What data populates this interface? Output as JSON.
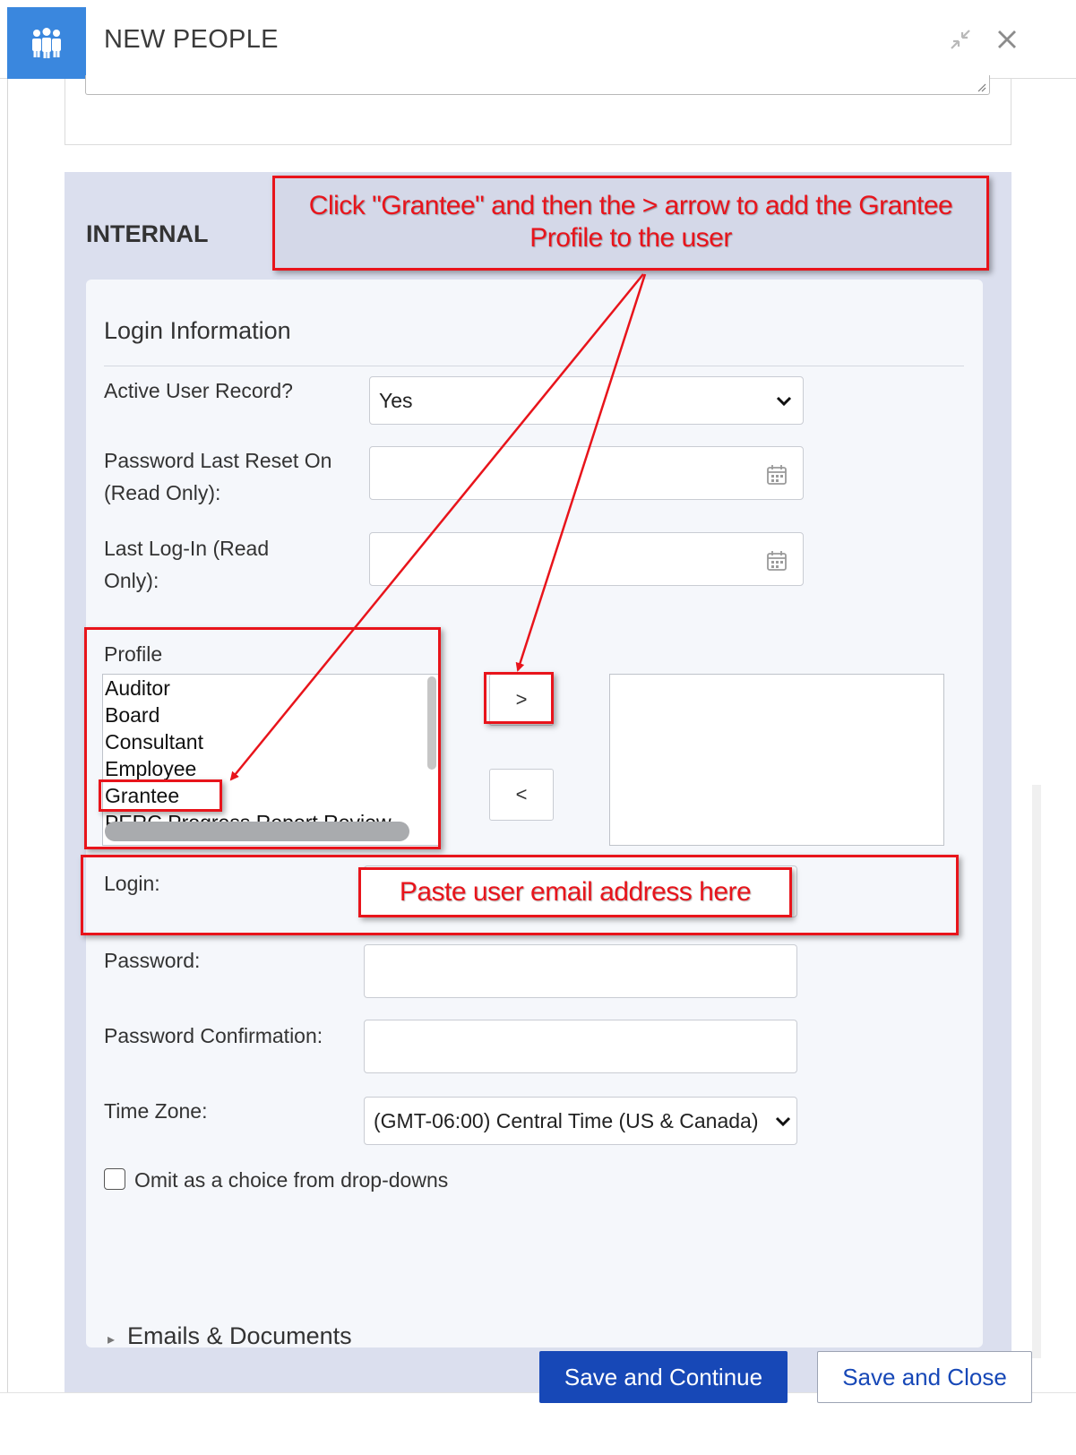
{
  "dialog": {
    "title": "NEW PEOPLE",
    "app_icon": "people-group-icon",
    "accent_color": "#3a87de",
    "controls": [
      "minimize-icon",
      "close-icon"
    ]
  },
  "internal": {
    "title": "INTERNAL",
    "login_info": {
      "title": "Login Information",
      "active_user_label": "Active User Record?",
      "active_user_value": "Yes",
      "password_reset_label": "Password Last Reset On (Read Only):",
      "password_reset_value": "",
      "last_login_label": "Last Log-In (Read Only):",
      "last_login_value": "",
      "profile_label": "Profile",
      "profile_options": [
        "Auditor",
        "Board",
        "Consultant",
        "Employee",
        "Grantee",
        "PERC Progress Report Review"
      ],
      "add_button": ">",
      "remove_button": "<",
      "login_label": "Login:",
      "login_value": "",
      "password_label": "Password:",
      "password_value": "",
      "password_confirm_label": "Password Confirmation:",
      "password_confirm_value": "",
      "timezone_label": "Time Zone:",
      "timezone_value": "(GMT-06:00) Central Time (US & Canada)",
      "omit_label": "Omit as a choice from drop-downs",
      "omit_checked": false
    }
  },
  "next_section_label": "Emails & Documents",
  "footer": {
    "save_continue": "Save and Continue",
    "save_close": "Save and Close",
    "primary_color": "#1748b7"
  },
  "annotations": {
    "color": "#e8141b",
    "grantee_instruction": "Click \"Grantee\" and then the > arrow to add the Grantee Profile to the user",
    "login_instruction": "Paste user email address here"
  }
}
